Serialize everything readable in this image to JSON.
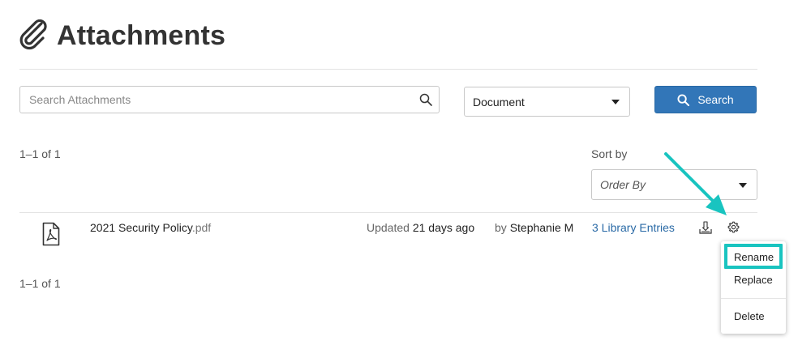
{
  "header": {
    "title": "Attachments",
    "icon": "paperclip-icon"
  },
  "search": {
    "placeholder": "Search Attachments",
    "value": "",
    "type_selected": "Document",
    "button_label": "Search"
  },
  "results": {
    "count_top": "1–1 of 1",
    "count_bottom": "1–1 of 1",
    "sort_label": "Sort by",
    "sort_selected": "Order By"
  },
  "file": {
    "name": "2021 Security Policy",
    "ext": ".pdf",
    "updated_label": "Updated",
    "updated_value": "21 days ago",
    "author_label": "by",
    "author_value": "Stephanie M",
    "library_link": "3 Library Entries"
  },
  "menu": {
    "items": [
      "Rename",
      "Replace",
      "Delete"
    ]
  },
  "colors": {
    "primary": "#3276b8",
    "link": "#2a6aa6",
    "annotation": "#19c4c0"
  }
}
